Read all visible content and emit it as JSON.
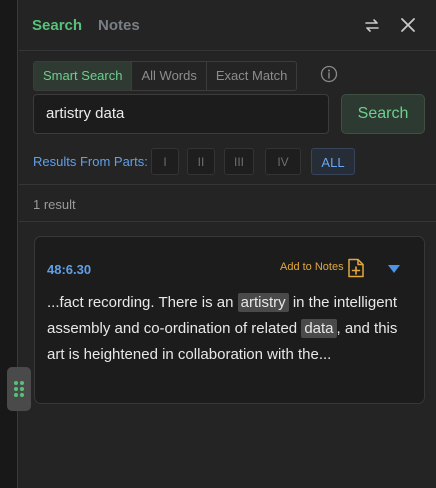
{
  "header": {
    "tabs": [
      {
        "label": "Search",
        "active": true
      },
      {
        "label": "Notes",
        "active": false
      }
    ],
    "swap_icon": "swap-arrows-icon",
    "close_icon": "close-icon"
  },
  "search_modes": [
    {
      "label": "Smart Search",
      "active": true
    },
    {
      "label": "All Words",
      "active": false
    },
    {
      "label": "Exact Match",
      "active": false
    }
  ],
  "info_icon": "info-icon",
  "search": {
    "query": "artistry data",
    "button_label": "Search"
  },
  "parts": {
    "label": "Results From Parts:",
    "options": [
      "I",
      "II",
      "III",
      "IV",
      "ALL"
    ],
    "selected": "ALL"
  },
  "results": {
    "count_text": "1 result",
    "items": [
      {
        "reference": "48:6.30",
        "add_label": "Add to Notes",
        "snippet": [
          {
            "t": "...fact recording. There is an ",
            "hl": false
          },
          {
            "t": "artistry",
            "hl": true
          },
          {
            "t": " in the intelligent assembly and co-ordination of related ",
            "hl": false
          },
          {
            "t": "data",
            "hl": true
          },
          {
            "t": ", and this art is heightened in collaboration with the...",
            "hl": false
          }
        ]
      }
    ]
  },
  "colors": {
    "accent_green": "#55c27a",
    "accent_blue": "#5fa0e8",
    "accent_orange": "#e2a83e",
    "background": "#242424"
  }
}
